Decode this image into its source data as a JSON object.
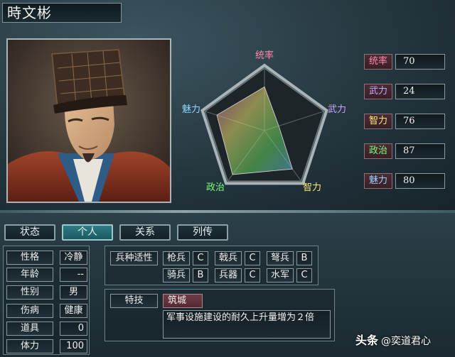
{
  "character": {
    "name": "時文彬"
  },
  "radar": {
    "labels": {
      "top": "统率",
      "right": "武力",
      "bottom_right": "智力",
      "bottom_left": "政治",
      "left": "魅力"
    },
    "values": [
      70,
      24,
      76,
      87,
      80
    ],
    "max": 100
  },
  "stats": [
    {
      "label": "统率",
      "value": "70",
      "color": "#ff8ab0"
    },
    {
      "label": "武力",
      "value": "24",
      "color": "#c9a6ff"
    },
    {
      "label": "智力",
      "value": "76",
      "color": "#ffe877"
    },
    {
      "label": "政治",
      "value": "87",
      "color": "#7dff7d"
    },
    {
      "label": "魅力",
      "value": "80",
      "color": "#8fd6ff"
    }
  ],
  "tabs": [
    "状态",
    "个人",
    "关系",
    "列传"
  ],
  "active_tab": 1,
  "personal": [
    {
      "label": "性格",
      "value": "冷静"
    },
    {
      "label": "年龄",
      "value": "--"
    },
    {
      "label": "性别",
      "value": "男"
    },
    {
      "label": "伤病",
      "value": "健康"
    },
    {
      "label": "道具",
      "value": "0"
    },
    {
      "label": "体力",
      "value": "100"
    }
  ],
  "aptitude": {
    "title": "兵种适性",
    "row1": [
      {
        "label": "枪兵",
        "grade": "C"
      },
      {
        "label": "戟兵",
        "grade": "C"
      },
      {
        "label": "弩兵",
        "grade": "B"
      }
    ],
    "row2": [
      {
        "label": "骑兵",
        "grade": "B"
      },
      {
        "label": "兵器",
        "grade": "C"
      },
      {
        "label": "水军",
        "grade": "C"
      }
    ]
  },
  "skill": {
    "title": "特技",
    "name": "筑城",
    "description": "军事设施建设的耐久上升量增为２倍"
  },
  "watermark": {
    "brand": "头条",
    "handle": "@奕道君心"
  }
}
